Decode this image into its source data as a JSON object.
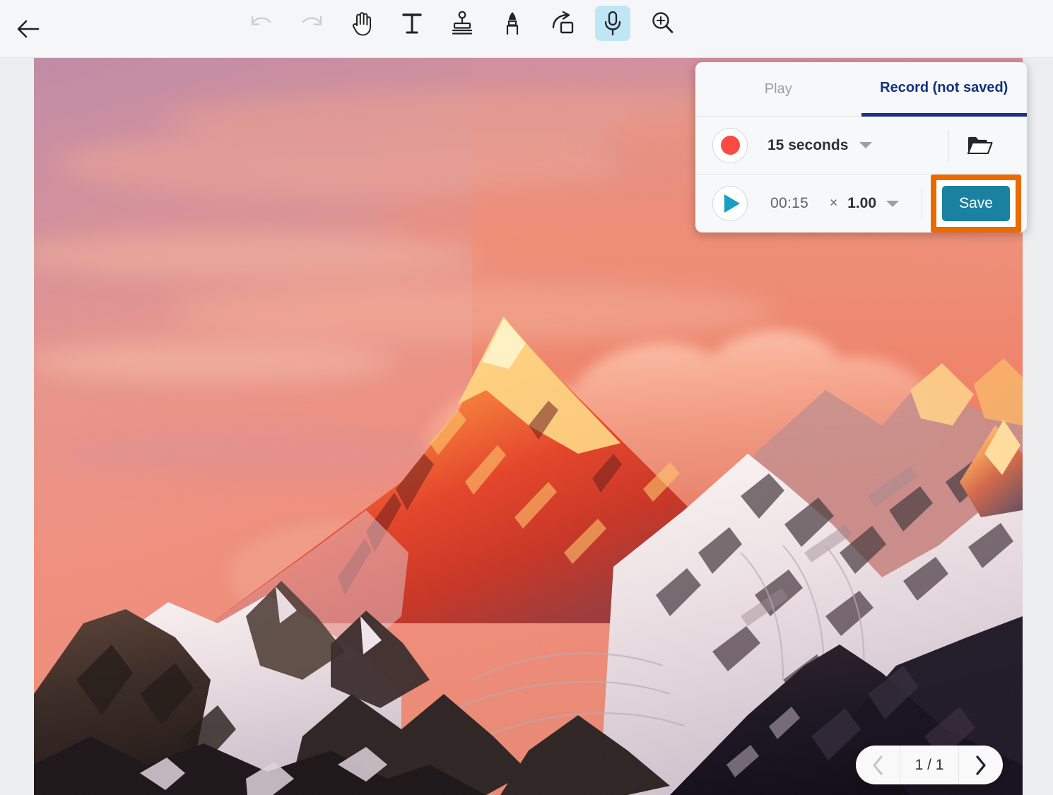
{
  "toolbar": {
    "back_icon": "back-arrow-icon",
    "tools": [
      {
        "name": "undo-icon",
        "label": "Undo",
        "state": "disabled"
      },
      {
        "name": "redo-icon",
        "label": "Redo",
        "state": "disabled"
      },
      {
        "name": "hand-icon",
        "label": "Pan",
        "state": "normal"
      },
      {
        "name": "text-icon",
        "label": "Text",
        "state": "normal"
      },
      {
        "name": "stamp-icon",
        "label": "Stamp",
        "state": "normal"
      },
      {
        "name": "pen-icon",
        "label": "Pen",
        "state": "normal"
      },
      {
        "name": "share-icon",
        "label": "Share",
        "state": "normal"
      },
      {
        "name": "microphone-icon",
        "label": "Voice",
        "state": "active"
      },
      {
        "name": "zoom-in-icon",
        "label": "Zoom In",
        "state": "normal"
      }
    ]
  },
  "recorder": {
    "tabs": [
      {
        "label": "Play",
        "active": false
      },
      {
        "label": "Record (not saved)",
        "active": true
      }
    ],
    "record_row": {
      "record_button_icon": "record-dot-icon",
      "duration": "15 seconds",
      "duration_caret_icon": "chevron-down-icon",
      "folder_icon": "open-folder-icon"
    },
    "play_row": {
      "play_button_icon": "play-triangle-icon",
      "time": "00:15",
      "speed_prefix": "×",
      "speed_value": "1.00",
      "speed_caret_icon": "chevron-down-icon",
      "save_label": "Save"
    },
    "colors": {
      "active_tab_text": "#13307f",
      "active_tab_underline": "#1a3380",
      "inactive_tab_text": "#9aa0a6",
      "record_dot": "#fa4b42",
      "play_triangle": "#1a9ec4",
      "save_button": "#1a82a0",
      "highlight_border": "#ea6a00"
    }
  },
  "pager": {
    "prev_icon": "chevron-left-icon",
    "count": "1 / 1",
    "next_icon": "chevron-right-icon"
  },
  "photo": {
    "description": "Mount Everest at sunset with pink sky and snow covered peaks"
  }
}
